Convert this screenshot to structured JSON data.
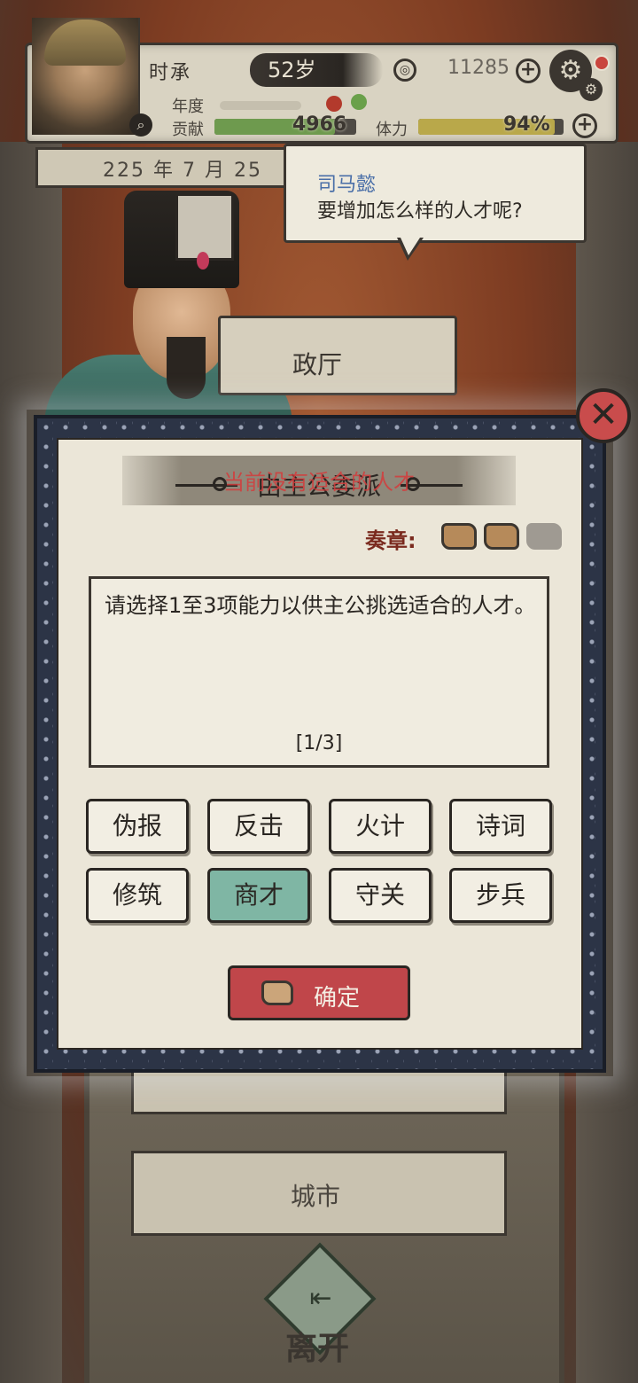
{
  "player": {
    "name": "时承",
    "age": "52岁",
    "coins": "11285",
    "year_label": "年度",
    "contribution_label": "贡献",
    "contribution_value": "4966",
    "stamina_label": "体力",
    "stamina_value": "94%",
    "contribution_fill": 0.85,
    "stamina_fill": 0.94
  },
  "date": "225 年 7 月 25",
  "dialogue": {
    "speaker": "司马懿",
    "text": "要增加怎么样的人才呢?"
  },
  "background": {
    "hall_label": "政厅",
    "city_label": "城市",
    "leave_label": "离开"
  },
  "dialog": {
    "title": "由主公委派",
    "overlay_text": "当前没有适合的人才",
    "memo_label": "奏章:",
    "memo_count_filled": 2,
    "memo_count_total": 3,
    "description": "请选择1至3项能力以供主公挑选适合的人才。",
    "pager": "[1/3]",
    "options": [
      {
        "label": "伪报",
        "selected": false
      },
      {
        "label": "反击",
        "selected": false
      },
      {
        "label": "火计",
        "selected": false
      },
      {
        "label": "诗词",
        "selected": false
      },
      {
        "label": "修筑",
        "selected": false
      },
      {
        "label": "商才",
        "selected": true
      },
      {
        "label": "守关",
        "selected": false
      },
      {
        "label": "步兵",
        "selected": false
      }
    ],
    "confirm_label": "确定"
  },
  "colors": {
    "selected_option": "#7fb6a4",
    "confirm_button": "#c0464a",
    "close_button": "#c94c4c",
    "speaker_name": "#4a6fa8"
  }
}
